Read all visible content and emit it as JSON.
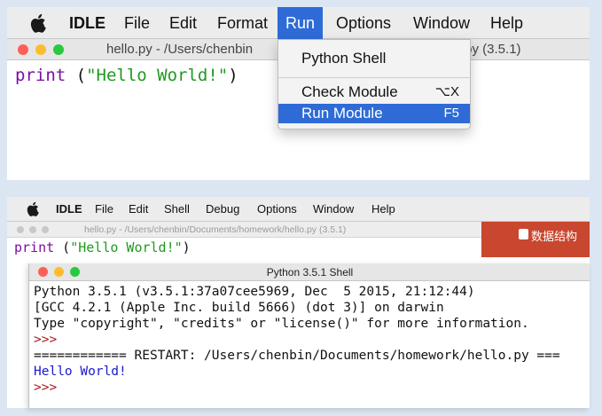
{
  "top_menubar": {
    "app": "IDLE",
    "items": [
      "File",
      "Edit",
      "Format",
      "Run",
      "Options",
      "Window",
      "Help"
    ]
  },
  "editor_window": {
    "title_left": "hello.py - /Users/chenbin",
    "title_right": ".py (3.5.1)",
    "code": {
      "keyword": "print",
      "open": " (",
      "string": "\"Hello World!\"",
      "close": ")"
    }
  },
  "run_menu": {
    "items": [
      {
        "label": "Python Shell",
        "shortcut": ""
      },
      {
        "label": "Check Module",
        "shortcut": "⌥X"
      },
      {
        "label": "Run Module",
        "shortcut": "F5"
      }
    ]
  },
  "bottom_menubar": {
    "app": "IDLE",
    "items": [
      "File",
      "Edit",
      "Shell",
      "Debug",
      "Options",
      "Window",
      "Help"
    ]
  },
  "editor_window2": {
    "title": "hello.py - /Users/chenbin/Documents/homework/hello.py (3.5.1)",
    "code": {
      "keyword": "print",
      "open": " (",
      "string": "\"Hello World!\"",
      "close": ")"
    }
  },
  "side_app": {
    "label": "数据结构"
  },
  "shell_window": {
    "title": "Python 3.5.1 Shell",
    "lines": {
      "l1": "Python 3.5.1 (v3.5.1:37a07cee5969, Dec  5 2015, 21:12:44)",
      "l2": "[GCC 4.2.1 (Apple Inc. build 5666) (dot 3)] on darwin",
      "l3": "Type \"copyright\", \"credits\" or \"license()\" for more information.",
      "p1": ">>>",
      "l4": "============ RESTART: /Users/chenbin/Documents/homework/hello.py ===",
      "l5": "Hello World!",
      "p2": ">>>"
    }
  },
  "colors": {
    "keyword": "#7a0fa0",
    "string": "#1f9a1f",
    "prompt": "#a61a1a",
    "output": "#1a1acc",
    "menu_highlight": "#2e6bd6",
    "close_dot": "#fd5f57",
    "minimize_dot": "#fdbc2e",
    "zoom_dot": "#28c940"
  }
}
